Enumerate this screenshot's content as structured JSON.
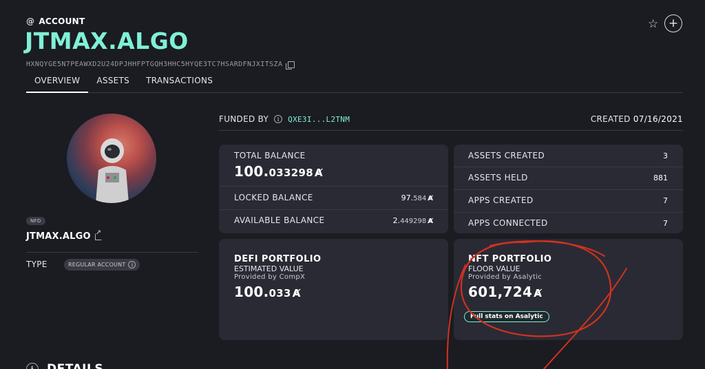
{
  "header": {
    "section_label": "ACCOUNT",
    "title": "JTMAX.ALGO",
    "address": "HXNQYGE5N7PEAWXD2U24DPJHHFPTGQH3HHC5HYQE3TC7HSARDFNJXITSZA"
  },
  "tabs": [
    {
      "label": "OVERVIEW",
      "active": true
    },
    {
      "label": "ASSETS",
      "active": false
    },
    {
      "label": "TRANSACTIONS",
      "active": false
    }
  ],
  "profile": {
    "nfd_badge": "NFD",
    "nfd_name": "JTMAX.ALGO",
    "type_label": "TYPE",
    "type_value": "REGULAR ACCOUNT"
  },
  "funding": {
    "funded_by_label": "FUNDED BY",
    "funded_by_address": "QXE3I...L2TNM",
    "created_label": "CREATED",
    "created_date": "07/16/2021"
  },
  "balance": {
    "total_label": "TOTAL BALANCE",
    "total_int": "100.",
    "total_frac": "033298",
    "locked_label": "LOCKED BALANCE",
    "locked_int": "97.",
    "locked_frac": "584",
    "available_label": "AVAILABLE BALANCE",
    "available_int": "2.",
    "available_frac": "449298",
    "algo_symbol": "Ⱥ"
  },
  "stats": {
    "rows": [
      {
        "label": "ASSETS CREATED",
        "value": "3"
      },
      {
        "label": "ASSETS HELD",
        "value": "881"
      },
      {
        "label": "APPS CREATED",
        "value": "7"
      },
      {
        "label": "APPS CONNECTED",
        "value": "7"
      }
    ]
  },
  "defi": {
    "title": "DEFI PORTFOLIO",
    "subtitle": "ESTIMATED VALUE",
    "provider": "Provided by CompX",
    "value_int": "100.",
    "value_frac": "033"
  },
  "nft": {
    "title": "NFT PORTFOLIO",
    "subtitle": "FLOOR VALUE",
    "provider": "Provided by Asalytic",
    "value": "601,724",
    "link_label": "Full stats on Asalytic"
  },
  "footer": {
    "details_label": "DETAILS"
  },
  "colors": {
    "background": "#1b1b22",
    "card": "#2a2a35",
    "accent": "#7ff0d6",
    "annotation_red": "#d2321e"
  },
  "icons": [
    "at-icon",
    "copy-icon",
    "star-icon",
    "plus-icon",
    "external-link-icon",
    "info-icon"
  ]
}
